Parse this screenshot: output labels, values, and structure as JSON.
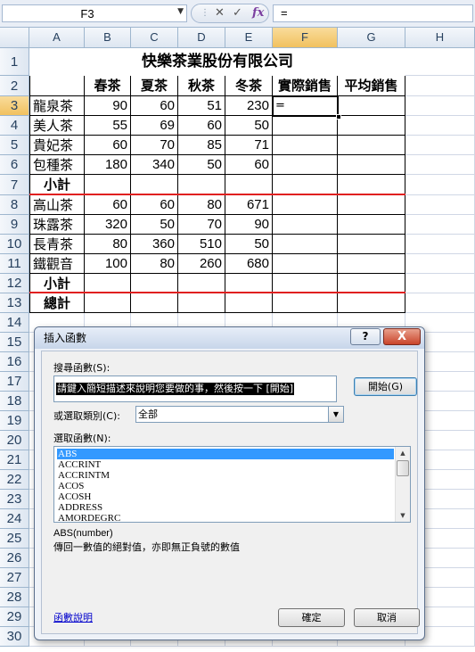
{
  "formula_bar": {
    "name_box": "F3",
    "name_box_arrow": "▼",
    "cancel_symbol": "✕",
    "enter_symbol": "✓",
    "fx_symbol": "fx",
    "content": "="
  },
  "columns": [
    "A",
    "B",
    "C",
    "D",
    "E",
    "F",
    "G",
    "H"
  ],
  "rows": [
    "1",
    "2",
    "3",
    "4",
    "5",
    "6",
    "7",
    "8",
    "9",
    "10",
    "11",
    "12",
    "13",
    "14",
    "15",
    "16",
    "17",
    "18",
    "19",
    "20",
    "21",
    "22",
    "23",
    "24",
    "25",
    "26",
    "27",
    "28",
    "29",
    "30"
  ],
  "sheet": {
    "title": "快樂茶業股份有限公司",
    "headers": [
      "春茶",
      "夏茶",
      "秋茶",
      "冬茶",
      "實際銷售",
      "平均銷售"
    ],
    "group1": [
      {
        "name": "龍泉茶",
        "values": [
          "90",
          "60",
          "51",
          "230"
        ]
      },
      {
        "name": "美人茶",
        "values": [
          "55",
          "69",
          "60",
          "50"
        ]
      },
      {
        "name": "貴妃茶",
        "values": [
          "60",
          "70",
          "85",
          "71"
        ]
      },
      {
        "name": "包種茶",
        "values": [
          "180",
          "340",
          "50",
          "60"
        ]
      }
    ],
    "subtotal1": "小計",
    "group2": [
      {
        "name": "高山茶",
        "values": [
          "60",
          "60",
          "80",
          "671"
        ]
      },
      {
        "name": "珠露茶",
        "values": [
          "320",
          "50",
          "70",
          "90"
        ]
      },
      {
        "name": "長青茶",
        "values": [
          "80",
          "360",
          "510",
          "50"
        ]
      },
      {
        "name": "鐵觀音",
        "values": [
          "100",
          "80",
          "260",
          "680"
        ]
      }
    ],
    "subtotal2": "小計",
    "total": "總計",
    "active_cell_content": "="
  },
  "dialog": {
    "title": "插入函數",
    "help_symbol": "?",
    "close_symbol": "X",
    "search_label": "搜尋函數(S):",
    "search_value": "請鍵入簡短描述來說明您要做的事，然後按一下 [開始]",
    "go_button": "開始(G)",
    "category_label": "或選取類別(C):",
    "category_value": "全部",
    "category_arrow": "▼",
    "function_list_label": "選取函數(N):",
    "functions": [
      "ABS",
      "ACCRINT",
      "ACCRINTM",
      "ACOS",
      "ACOSH",
      "ADDRESS",
      "AMORDEGRC"
    ],
    "selected_function": "ABS",
    "scroll_up": "▲",
    "scroll_down": "▼",
    "signature": "ABS(number)",
    "description": "傳回一數值的絕對值，亦即無正負號的數值",
    "help_link": "函數說明",
    "ok_button": "確定",
    "cancel_button": "取消"
  }
}
